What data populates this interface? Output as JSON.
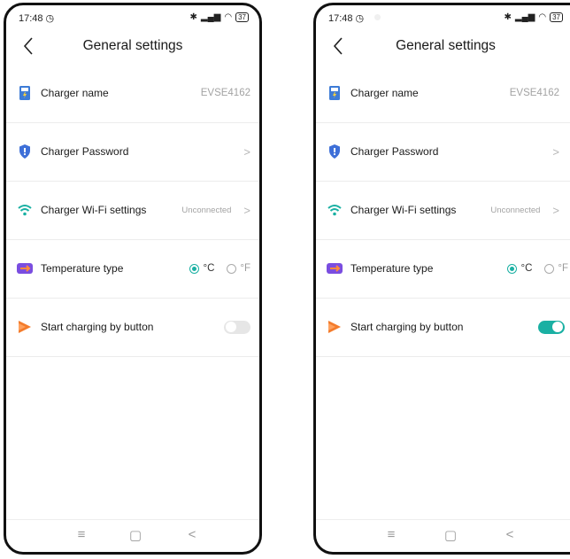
{
  "colors": {
    "accent": "#1ab0a3",
    "icon_blue": "#3d7bd6",
    "icon_purple": "#7a4de0",
    "icon_orange": "#f47c2c"
  },
  "phones": [
    {
      "status": {
        "time": "17:48",
        "clock_icon": "alarm-clock-icon",
        "battery": "37"
      },
      "title": "General settings",
      "rows": {
        "charger_name": {
          "label": "Charger name",
          "value": "EVSE4162"
        },
        "charger_password": {
          "label": "Charger Password"
        },
        "wifi": {
          "label": "Charger Wi-Fi settings",
          "status": "Unconnected"
        },
        "temperature": {
          "label": "Temperature type",
          "option_c": "°C",
          "option_f": "°F",
          "selected": "°C"
        },
        "start_button": {
          "label": "Start charging by button",
          "enabled": false
        }
      },
      "nav": {
        "menu": "≡",
        "home": "▢",
        "back": "<"
      }
    },
    {
      "status": {
        "time": "17:48",
        "clock_icon": "alarm-clock-icon",
        "battery": "37"
      },
      "title": "General settings",
      "rows": {
        "charger_name": {
          "label": "Charger name",
          "value": "EVSE4162"
        },
        "charger_password": {
          "label": "Charger Password"
        },
        "wifi": {
          "label": "Charger Wi-Fi settings",
          "status": "Unconnected"
        },
        "temperature": {
          "label": "Temperature type",
          "option_c": "°C",
          "option_f": "°F",
          "selected": "°C"
        },
        "start_button": {
          "label": "Start charging by button",
          "enabled": true
        }
      },
      "nav": {
        "menu": "≡",
        "home": "▢",
        "back": "<"
      }
    }
  ]
}
